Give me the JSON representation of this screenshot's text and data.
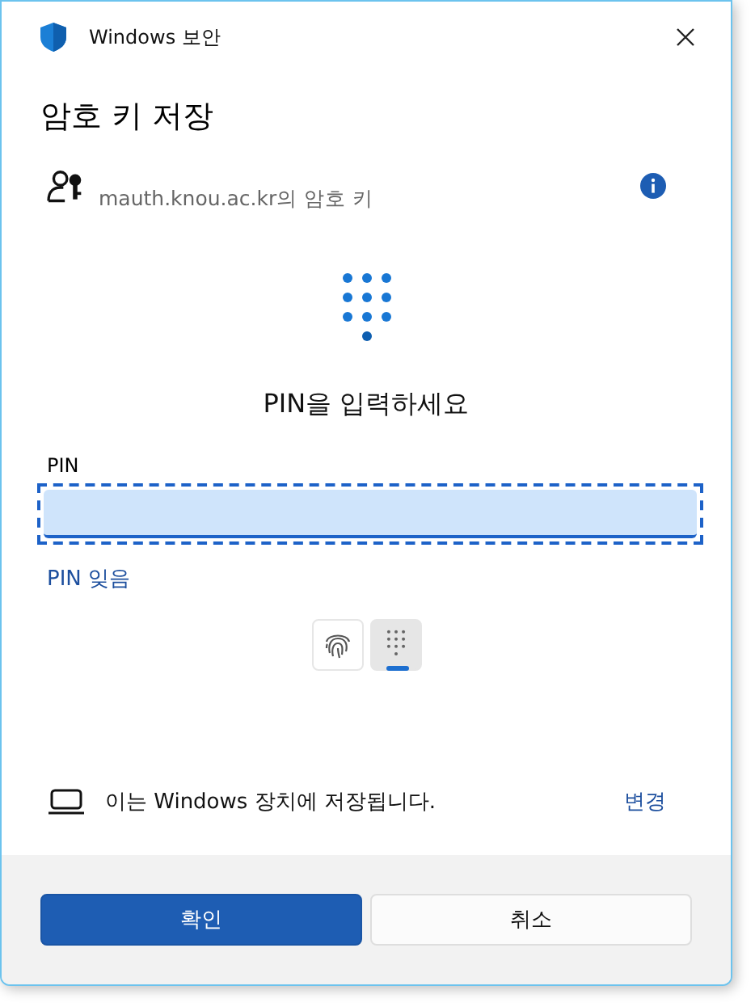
{
  "window": {
    "title": "Windows 보안"
  },
  "heading": "암호 키 저장",
  "account": {
    "text": "mauth.knou.ac.kr의 암호 키"
  },
  "prompt": "PIN을 입력하세요",
  "pin_field": {
    "label": "PIN",
    "focused": true
  },
  "forgot_link": "PIN 잊음",
  "auth_methods": [
    {
      "kind": "fingerprint",
      "selected": false
    },
    {
      "kind": "pin",
      "selected": true
    }
  ],
  "storage": {
    "text": "이는 Windows 장치에 저장됩니다.",
    "link": "변경"
  },
  "buttons": [
    {
      "label": "확인",
      "kind": "primary"
    },
    {
      "label": "취소",
      "kind": "secondary"
    }
  ]
}
